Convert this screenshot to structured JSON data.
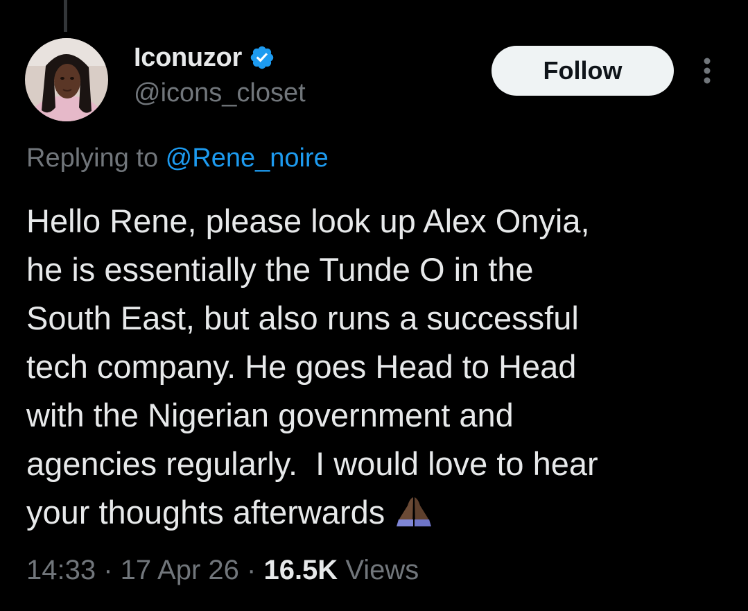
{
  "author": {
    "display_name": "Iconuzor",
    "handle": "@icons_closet",
    "avatar_icon": "profile-photo",
    "verified_icon": "verified-badge-icon"
  },
  "follow_button": {
    "label": "Follow"
  },
  "more_icon": "more-vertical-icon",
  "reply": {
    "prefix": "Replying to ",
    "mention": "@Rene_noire"
  },
  "tweet": {
    "lines": [
      "Hello Rene, please look up Alex Onyia,",
      "he is essentially the Tunde O in the",
      "South East, but also runs a successful",
      "tech company. He goes Head to Head",
      "with the Nigerian government and",
      "agencies regularly.  I would love to hear",
      "your thoughts afterwards"
    ],
    "emoji": "🙏🏾"
  },
  "meta": {
    "time": "14:33",
    "sep1": " · ",
    "date": "17 Apr 26",
    "sep2": " · ",
    "views_count": "16.5K",
    "views_label": " Views"
  },
  "colors": {
    "background": "#000000",
    "text": "#e7e9ea",
    "secondary": "#71767b",
    "link": "#1d9bf0",
    "button_bg": "#eff3f4"
  }
}
